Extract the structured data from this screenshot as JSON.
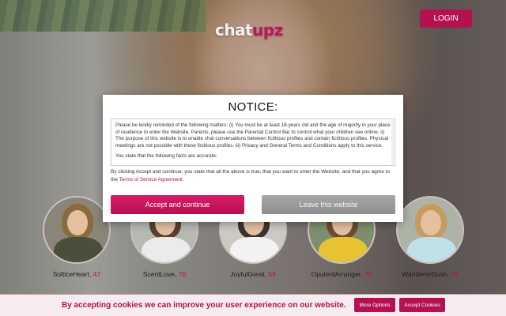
{
  "header": {
    "logo_part1": "chat",
    "logo_part2": "upz",
    "login_label": "LOGIN"
  },
  "profiles": [
    {
      "name": "SolticeHeart",
      "age": "47",
      "hair": "#8a6b3e",
      "body": "#4a4f3c"
    },
    {
      "name": "ScentLove",
      "age": "76",
      "hair": "#5a3f2e",
      "body": "#ebebeb"
    },
    {
      "name": "JoyfulGreat",
      "age": "58",
      "hair": "#3b3330",
      "body": "#f2f2f2"
    },
    {
      "name": "OpulentArranger",
      "age": "76",
      "hair": "#6b4d32",
      "body": "#e8c233"
    },
    {
      "name": "WandererGush",
      "age": "24",
      "hair": "#c79b5c",
      "body": "#bfe0e6"
    }
  ],
  "modal": {
    "title": "NOTICE:",
    "paragraph1": "Please be kindly reminded of the following matters: (i) You must be at least 18-years old and the age of majority in your place of residence to enter the Website. Parents, please use the Parental Control Bar to control what your children see online. ii) The purpose of this website is to enable chat conversations between fictitious profiles and contain fictitious profiles. Physical meetings are not possible with these fictitious profiles. iii) Privacy and General Terms and Conditions apply to this service.",
    "paragraph2": "You state that the following facts are accurate:",
    "accept_note": "By clicking Accept and continue, you state that all the above is true, that you want to enter the Website, and that you agree to the",
    "tos_link": "Terms of Service Agreement",
    "accept_label": "Accept and continue",
    "leave_label": "Leave this website"
  },
  "cookie_bar": {
    "text": "By accepting cookies we can improve your user experience on our website.",
    "more_label": "More Options",
    "accept_label": "Accept Cookies"
  },
  "colors": {
    "brand": "#b3124f",
    "leave_button": "#9a9a9a"
  }
}
